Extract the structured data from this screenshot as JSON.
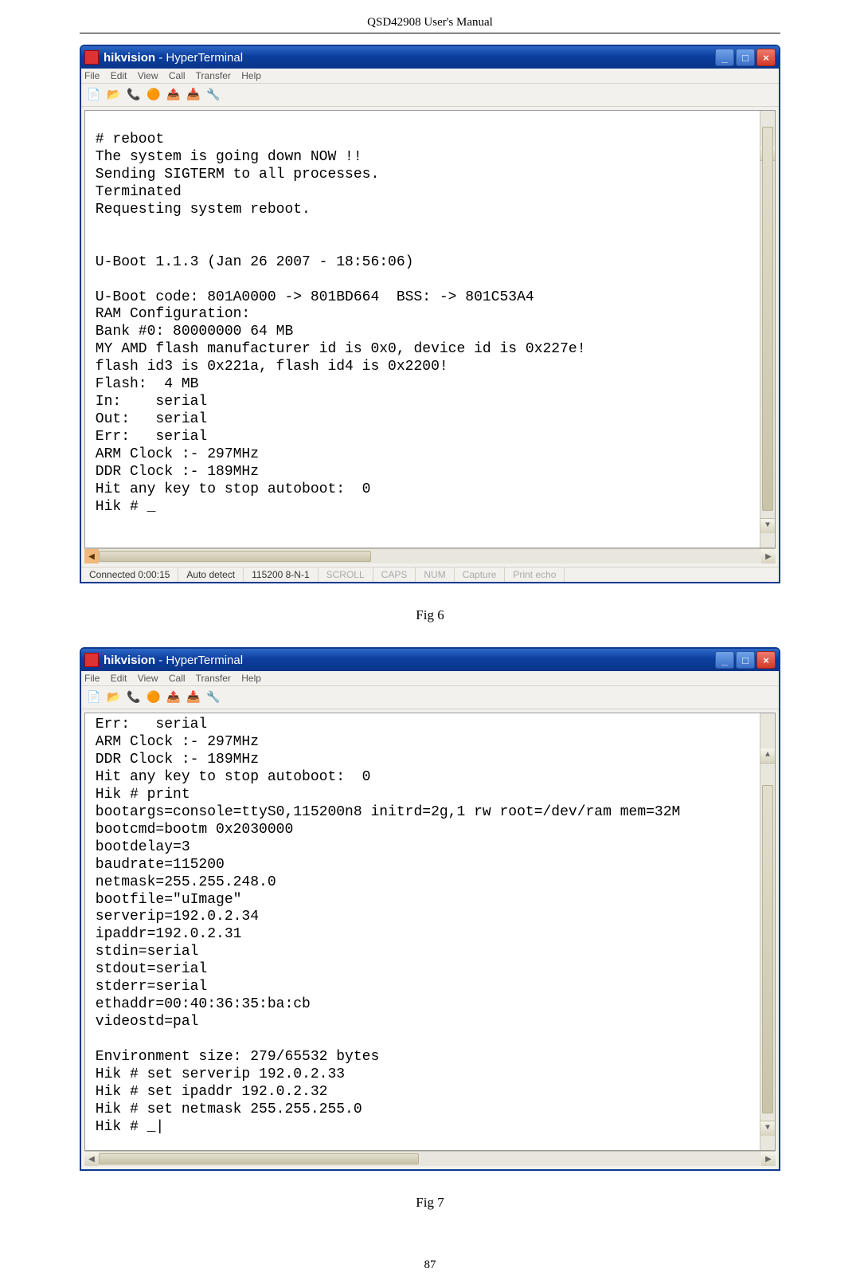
{
  "page_header": "QSD42908 User's Manual",
  "window1": {
    "title_app": "hikvision",
    "title_sep": " - ",
    "title_prog": "HyperTerminal",
    "menu": [
      "File",
      "Edit",
      "View",
      "Call",
      "Transfer",
      "Help"
    ],
    "toolbar_icons": [
      "new-icon",
      "open-icon",
      "connect-icon",
      "disconnect-icon",
      "send-icon",
      "receive-icon",
      "properties-icon"
    ],
    "terminal": "\n # reboot\n The system is going down NOW !!\n Sending SIGTERM to all processes.\n Terminated\n Requesting system reboot.\n\n\n U-Boot 1.1.3 (Jan 26 2007 - 18:56:06)\n\n U-Boot code: 801A0000 -> 801BD664  BSS: -> 801C53A4\n RAM Configuration:\n Bank #0: 80000000 64 MB\n MY AMD flash manufacturer id is 0x0, device id is 0x227e!\n flash id3 is 0x221a, flash id4 is 0x2200!\n Flash:  4 MB\n In:    serial\n Out:   serial\n Err:   serial\n ARM Clock :- 297MHz\n DDR Clock :- 189MHz\n Hit any key to stop autoboot:  0\n Hik # _\n",
    "status": {
      "connected": "Connected 0:00:15",
      "detect": "Auto detect",
      "params": "115200 8-N-1",
      "scroll": "SCROLL",
      "caps": "CAPS",
      "num": "NUM",
      "capture": "Capture",
      "echo": "Print echo"
    }
  },
  "caption1": "Fig 6",
  "window2": {
    "title_app": "hikvision",
    "title_sep": " - ",
    "title_prog": "HyperTerminal",
    "menu": [
      "File",
      "Edit",
      "View",
      "Call",
      "Transfer",
      "Help"
    ],
    "toolbar_icons": [
      "new-icon",
      "open-icon",
      "connect-icon",
      "disconnect-icon",
      "send-icon",
      "receive-icon",
      "properties-icon"
    ],
    "terminal": " Err:   serial\n ARM Clock :- 297MHz\n DDR Clock :- 189MHz\n Hit any key to stop autoboot:  0\n Hik # print\n bootargs=console=ttyS0,115200n8 initrd=2g,1 rw root=/dev/ram mem=32M\n bootcmd=bootm 0x2030000\n bootdelay=3\n baudrate=115200\n netmask=255.255.248.0\n bootfile=\"uImage\"\n serverip=192.0.2.34\n ipaddr=192.0.2.31\n stdin=serial\n stdout=serial\n stderr=serial\n ethaddr=00:40:36:35:ba:cb\n videostd=pal\n\n Environment size: 279/65532 bytes\n Hik # set serverip 192.0.2.33\n Hik # set ipaddr 192.0.2.32\n Hik # set netmask 255.255.255.0\n Hik # _|\n"
  },
  "caption2": "Fig 7",
  "page_number": "87"
}
